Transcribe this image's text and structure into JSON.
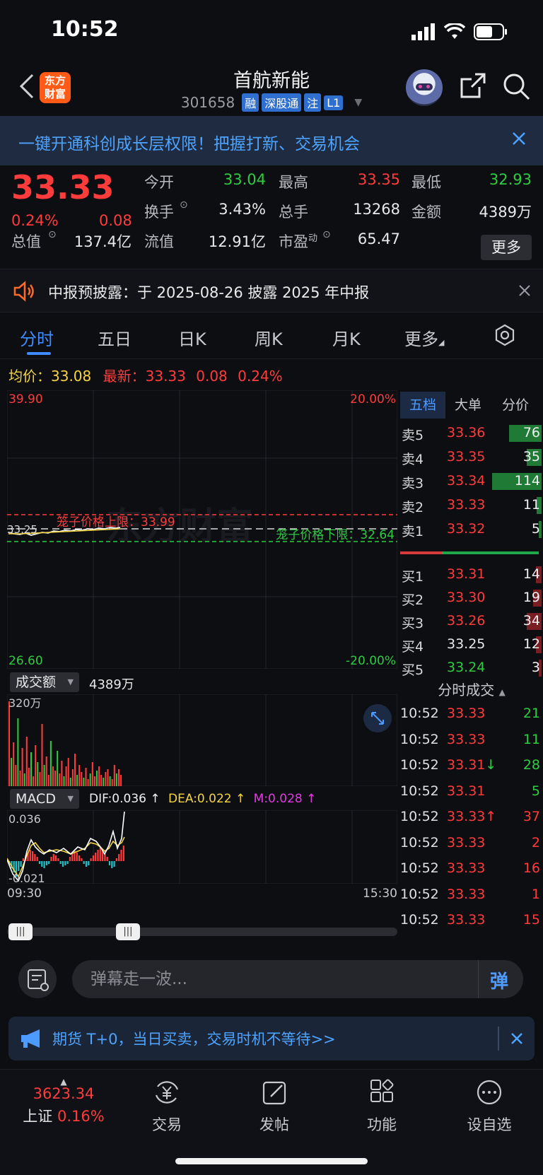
{
  "status_bar": {
    "time": "10:52"
  },
  "header": {
    "logo_line1": "东方",
    "logo_line2": "财富",
    "stock_name": "首航新能",
    "stock_code": "301658",
    "tags": [
      "融",
      "深股通",
      "注",
      "L1"
    ]
  },
  "promo_banner": {
    "text": "一键开通科创成长层权限！把握打新、交易机会"
  },
  "quote": {
    "last_price": "33.33",
    "change_pct": "0.24%",
    "change_amt": "0.08",
    "fields": [
      {
        "label": "今开",
        "value": "33.04",
        "color": "#2ecc40"
      },
      {
        "label": "最高",
        "value": "33.35",
        "color": "#ff3b3b"
      },
      {
        "label": "最低",
        "value": "32.93",
        "color": "#2ecc40"
      },
      {
        "label": "换手",
        "value": "3.43%",
        "color": "#e8e8e8"
      },
      {
        "label": "总手",
        "value": "13268",
        "color": "#e8e8e8"
      },
      {
        "label": "金额",
        "value": "4389万",
        "color": "#e8e8e8"
      },
      {
        "label": "总值",
        "value": "137.4亿",
        "color": "#e8e8e8"
      },
      {
        "label": "流值",
        "value": "12.91亿",
        "color": "#e8e8e8"
      },
      {
        "label": "市盈",
        "label_sup": "动",
        "value": "65.47",
        "color": "#e8e8e8"
      }
    ],
    "more_label": "更多"
  },
  "notice": {
    "text": "中报预披露：于 2025-08-26 披露 2025 年中报"
  },
  "tabs": [
    "分时",
    "五日",
    "日K",
    "周K",
    "月K",
    "更多"
  ],
  "avg_row": {
    "avg_label": "均价：",
    "avg_value": "33.08",
    "latest_label": "最新：",
    "latest_value": "33.33",
    "latest_change": "0.08",
    "latest_pct": "0.24%"
  },
  "intraday": {
    "y_max": "39.90",
    "y_min": "26.60",
    "pct_max": "20.00%",
    "pct_min": "-20.00%",
    "prev_close": "33.25",
    "upper_limit_label": "笼子价格上限：33.99",
    "lower_limit_label": "笼子价格下限：32.64",
    "x_start": "09:30",
    "x_end": "15:30",
    "watermark": "东方财富"
  },
  "volume": {
    "selector": "成交额",
    "value": "4389万",
    "axis_max": "320万"
  },
  "macd": {
    "selector": "MACD",
    "dif": "DIF:0.036 ↑",
    "dea": "DEA:0.022 ↑",
    "m": "M:0.028 ↑",
    "axis_max": "0.036",
    "axis_min": "-0.021"
  },
  "order_book": {
    "tabs": [
      "五档",
      "大单",
      "分价"
    ],
    "sells": [
      {
        "label": "卖5",
        "price": "33.36",
        "vol": "76",
        "bar": 0.66
      },
      {
        "label": "卖4",
        "price": "33.35",
        "vol": "35",
        "bar": 0.3
      },
      {
        "label": "卖3",
        "price": "33.34",
        "vol": "114",
        "bar": 1.0
      },
      {
        "label": "卖2",
        "price": "33.33",
        "vol": "11",
        "bar": 0.1
      },
      {
        "label": "卖1",
        "price": "33.32",
        "vol": "5",
        "bar": 0.05
      }
    ],
    "buys": [
      {
        "label": "买1",
        "price": "33.31",
        "vol": "14",
        "bar": 0.12,
        "color": "#ff3b3b"
      },
      {
        "label": "买2",
        "price": "33.30",
        "vol": "19",
        "bar": 0.17,
        "color": "#ff3b3b"
      },
      {
        "label": "买3",
        "price": "33.26",
        "vol": "34",
        "bar": 0.3,
        "color": "#ff3b3b"
      },
      {
        "label": "买4",
        "price": "33.25",
        "vol": "12",
        "bar": 0.11,
        "color": "#e8e8e8"
      },
      {
        "label": "买5",
        "price": "33.24",
        "vol": "3",
        "bar": 0.03,
        "color": "#2ecc40"
      }
    ]
  },
  "ticks": {
    "title": "分时成交",
    "rows": [
      {
        "time": "10:52",
        "price": "33.33",
        "arrow": "",
        "vol": "21",
        "vol_color": "#2ecc40"
      },
      {
        "time": "10:52",
        "price": "33.33",
        "arrow": "",
        "vol": "11",
        "vol_color": "#2ecc40"
      },
      {
        "time": "10:52",
        "price": "33.31",
        "arrow": "↓",
        "vol": "28",
        "vol_color": "#2ecc40"
      },
      {
        "time": "10:52",
        "price": "33.31",
        "arrow": "",
        "vol": "5",
        "vol_color": "#2ecc40"
      },
      {
        "time": "10:52",
        "price": "33.33",
        "arrow": "↑",
        "vol": "37",
        "vol_color": "#ff3b3b"
      },
      {
        "time": "10:52",
        "price": "33.33",
        "arrow": "",
        "vol": "2",
        "vol_color": "#ff3b3b"
      },
      {
        "time": "10:52",
        "price": "33.33",
        "arrow": "",
        "vol": "16",
        "vol_color": "#ff3b3b"
      },
      {
        "time": "10:52",
        "price": "33.33",
        "arrow": "",
        "vol": "1",
        "vol_color": "#ff3b3b"
      },
      {
        "time": "10:52",
        "price": "33.33",
        "arrow": "",
        "vol": "15",
        "vol_color": "#ff3b3b"
      }
    ]
  },
  "comment": {
    "placeholder": "弹幕走一波...",
    "button": "弹"
  },
  "ad": {
    "text": "期货 T+0，当日买卖，交易时机不等待>>"
  },
  "bottom_nav": {
    "index_value": "3623.34",
    "index_name": "上证",
    "index_pct": "0.16%",
    "items": [
      "交易",
      "发帖",
      "功能",
      "设自选"
    ]
  },
  "colors": {
    "up": "#ff3b3b",
    "down": "#2ecc40",
    "accent": "#3f8cff",
    "avg": "#f5d442"
  }
}
